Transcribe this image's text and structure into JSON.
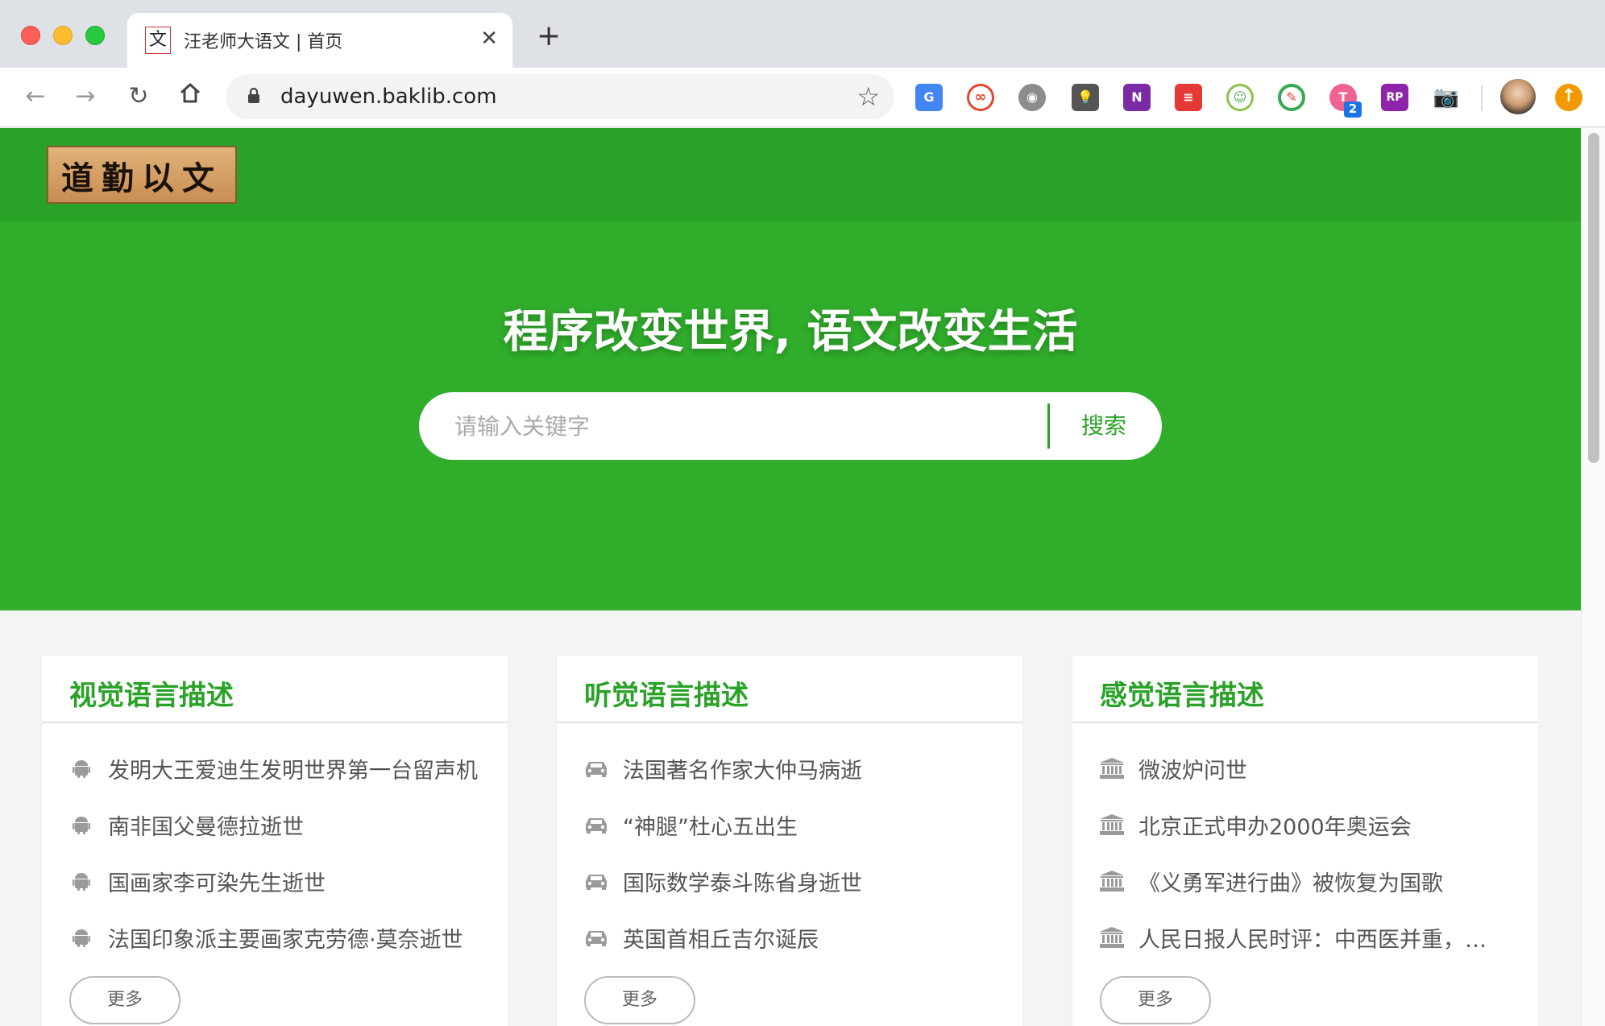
{
  "browser": {
    "tab_title": "汪老师大语文 | 首页",
    "tab_favicon": "文",
    "url": "dayuwen.baklib.com",
    "extension_badge": "2"
  },
  "header": {
    "logo_text": "道勤以文"
  },
  "hero": {
    "title": "程序改变世界, 语文改变生活",
    "search_placeholder": "请输入关键字",
    "search_button": "搜索"
  },
  "cards": [
    {
      "title": "视觉语言描述",
      "icon": "android-icon",
      "items": [
        "发明大王爱迪生发明世界第一台留声机",
        "南非国父曼德拉逝世",
        "国画家李可染先生逝世",
        "法国印象派主要画家克劳德·莫奈逝世"
      ],
      "more": "更多"
    },
    {
      "title": "听觉语言描述",
      "icon": "car-icon",
      "items": [
        "法国著名作家大仲马病逝",
        "“神腿”杜心五出生",
        "国际数学泰斗陈省身逝世",
        "英国首相丘吉尔诞辰"
      ],
      "more": "更多"
    },
    {
      "title": "感觉语言描述",
      "icon": "bank-icon",
      "items": [
        "微波炉问世",
        "北京正式申办2000年奥运会",
        "《义勇军进行曲》被恢复为国歌",
        "人民日报人民时评：中西医并重，各展所长"
      ],
      "more": "更多"
    }
  ],
  "colors": {
    "brand_green": "#2aa228",
    "hero_green": "#30ad2b"
  }
}
